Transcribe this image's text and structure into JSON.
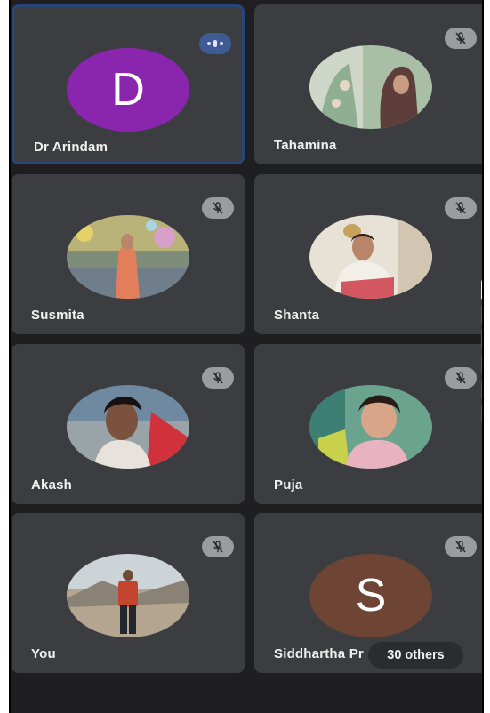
{
  "participants": [
    {
      "name": "Dr Arindam",
      "initial": "D",
      "avatar_color": "#8a26ad",
      "status": "speaking",
      "active": true
    },
    {
      "name": "Tahamina",
      "status": "muted",
      "photo": "woman-in-hijab"
    },
    {
      "name": "Susmita",
      "status": "muted",
      "photo": "woman-festival-lights"
    },
    {
      "name": "Shanta",
      "status": "muted",
      "photo": "elderly-woman-saree"
    },
    {
      "name": "Akash",
      "status": "muted",
      "photo": "young-man-portrait"
    },
    {
      "name": "Puja",
      "status": "muted",
      "photo": "woman-selfie"
    },
    {
      "name": "You",
      "status": "muted",
      "photo": "man-standing-outdoors"
    },
    {
      "name": "Siddhartha Pr",
      "initial": "S",
      "avatar_color": "#6e4434",
      "status": "muted"
    }
  ],
  "others_chip": "30 others",
  "colors": {
    "background": "#1f1f21",
    "tile": "#3c3d40",
    "active_border": "#29457a",
    "speaking_badge": "#3e5b93",
    "mute_badge": "#9a9ca0"
  },
  "icons": {
    "muted": "mic-off-icon",
    "speaking": "audio-level-icon"
  }
}
